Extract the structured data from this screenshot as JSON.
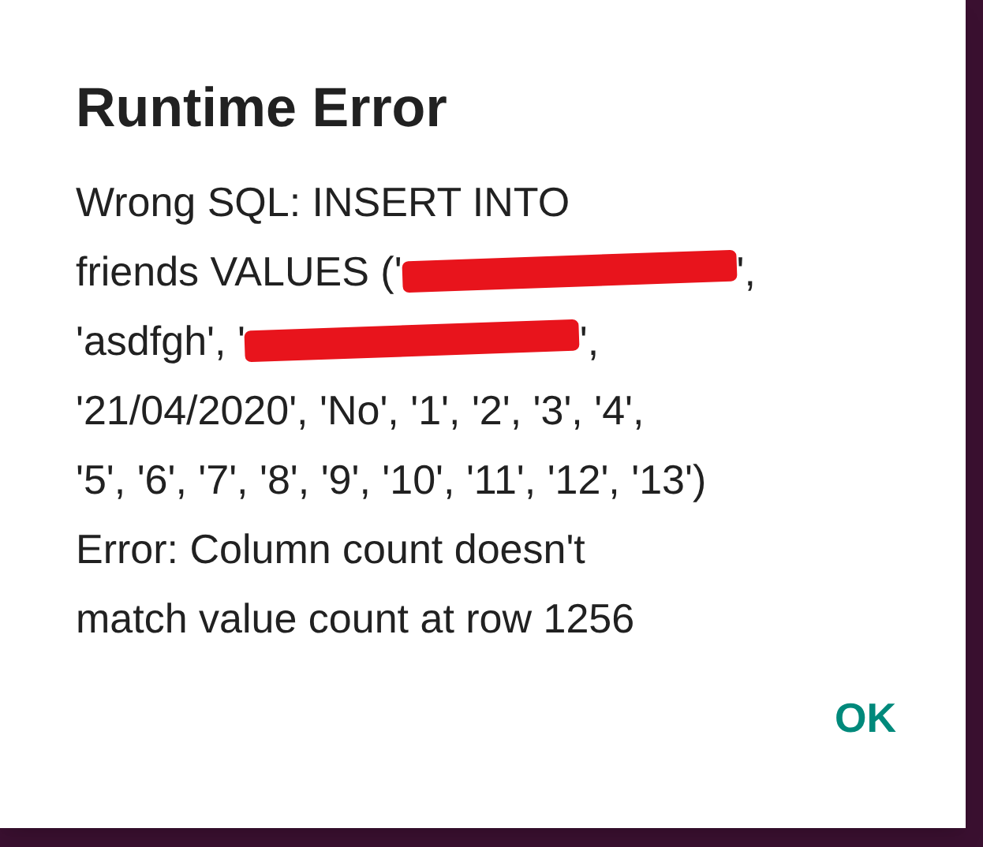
{
  "dialog": {
    "title": "Runtime Error",
    "lines": [
      [
        {
          "kind": "text",
          "text": "Wrong SQL: INSERT INTO"
        }
      ],
      [
        {
          "kind": "text",
          "text": "friends VALUES ('"
        },
        {
          "kind": "redacted"
        },
        {
          "kind": "text",
          "text": "',"
        }
      ],
      [
        {
          "kind": "text",
          "text": "'asdfgh', '"
        },
        {
          "kind": "redacted"
        },
        {
          "kind": "text",
          "text": "',"
        }
      ],
      [
        {
          "kind": "text",
          "text": "'21/04/2020', 'No', '1', '2', '3', '4',"
        }
      ],
      [
        {
          "kind": "text",
          "text": "'5', '6', '7', '8', '9', '10', '11', '12', '13')"
        }
      ],
      [
        {
          "kind": "text",
          "text": "Error: Column count doesn't"
        }
      ],
      [
        {
          "kind": "text",
          "text": "match value count at row 1256"
        }
      ]
    ],
    "button": "OK"
  }
}
